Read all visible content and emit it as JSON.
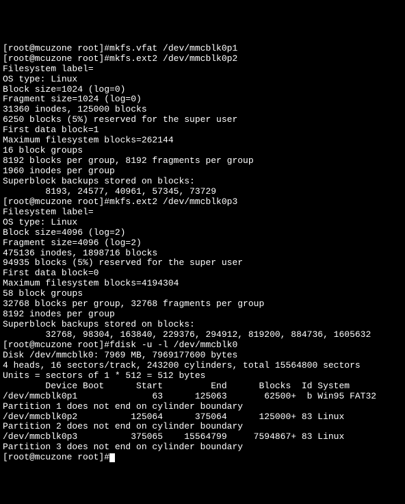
{
  "lines": [
    "[root@mcuzone root]#mkfs.vfat /dev/mmcblk0p1",
    "[root@mcuzone root]#mkfs.ext2 /dev/mmcblk0p2",
    "Filesystem label=",
    "OS type: Linux",
    "Block size=1024 (log=0)",
    "Fragment size=1024 (log=0)",
    "31360 inodes, 125000 blocks",
    "6250 blocks (5%) reserved for the super user",
    "First data block=1",
    "Maximum filesystem blocks=262144",
    "16 block groups",
    "8192 blocks per group, 8192 fragments per group",
    "1960 inodes per group",
    "Superblock backups stored on blocks:",
    "        8193, 24577, 40961, 57345, 73729",
    "[root@mcuzone root]#mkfs.ext2 /dev/mmcblk0p3",
    "Filesystem label=",
    "OS type: Linux",
    "Block size=4096 (log=2)",
    "Fragment size=4096 (log=2)",
    "475136 inodes, 1898716 blocks",
    "94935 blocks (5%) reserved for the super user",
    "First data block=0",
    "Maximum filesystem blocks=4194304",
    "58 block groups",
    "32768 blocks per group, 32768 fragments per group",
    "8192 inodes per group",
    "Superblock backups stored on blocks:",
    "        32768, 98304, 163840, 229376, 294912, 819200, 884736, 1605632",
    "[root@mcuzone root]#fdisk -u -l /dev/mmcblk0",
    "",
    "Disk /dev/mmcblk0: 7969 MB, 7969177600 bytes",
    "4 heads, 16 sectors/track, 243200 cylinders, total 15564800 sectors",
    "Units = sectors of 1 * 512 = 512 bytes",
    "",
    "        Device Boot      Start         End      Blocks  Id System",
    "/dev/mmcblk0p1              63      125063       62500+  b Win95 FAT32",
    "Partition 1 does not end on cylinder boundary",
    "/dev/mmcblk0p2          125064      375064      125000+ 83 Linux",
    "Partition 2 does not end on cylinder boundary",
    "/dev/mmcblk0p3          375065    15564799     7594867+ 83 Linux",
    "Partition 3 does not end on cylinder boundary"
  ],
  "prompt": "[root@mcuzone root]#"
}
